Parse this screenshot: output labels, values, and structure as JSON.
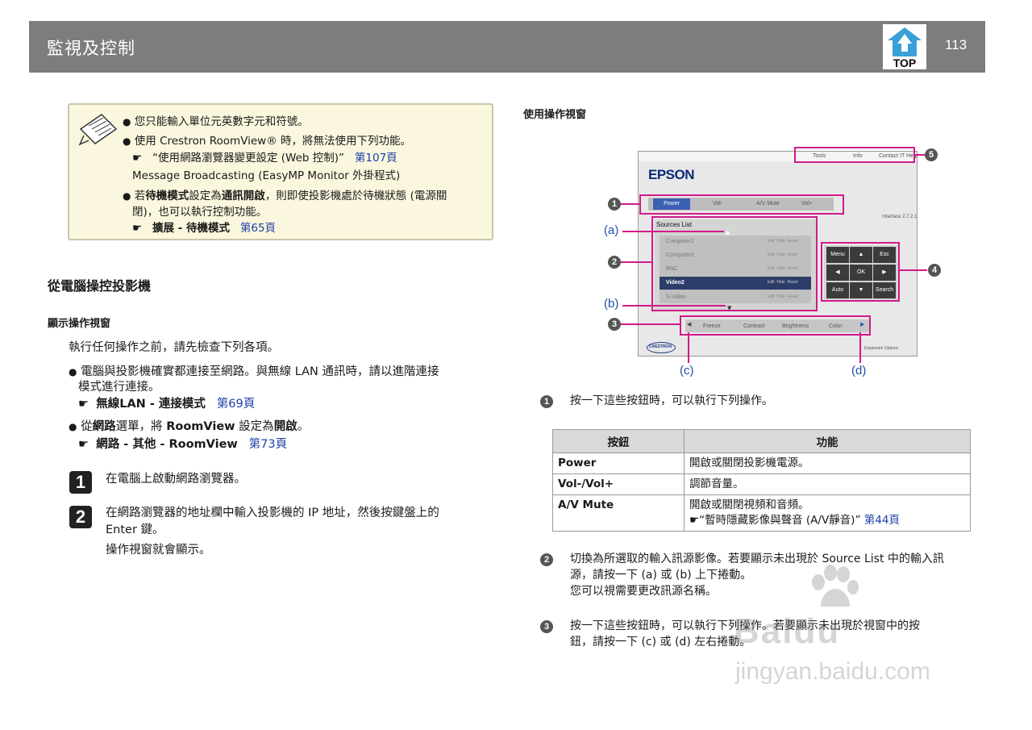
{
  "header": {
    "title": "監視及控制",
    "top_label": "TOP",
    "page_number": "113"
  },
  "note": {
    "bullet1": "您只能輸入單位元英數字元和符號。",
    "bullet2": "使用 Crestron RoomView® 時，將無法使用下列功能。",
    "bullet2_ref_text": "“使用網路瀏覽器變更設定 (Web 控制)”",
    "bullet2_ref_page": "第107頁",
    "bullet2_extra": "Message Broadcasting (EasyMP Monitor 外掛程式)",
    "bullet3_a": "若",
    "bullet3_b": "待機模式",
    "bullet3_c": "設定為",
    "bullet3_d": "通訊開啟",
    "bullet3_e": "，則即使投影機處於待機狀態 (電源關",
    "bullet3_line2": "閉)，也可以執行控制功能。",
    "bullet3_ref": "擴展 - 待機模式",
    "bullet3_ref_page": "第65頁"
  },
  "left": {
    "section_title": "從電腦操控投影機",
    "subsection_title": "顯示操作視窗",
    "intro": "執行任何操作之前，請先檢查下列各項。",
    "check1_line1": "電腦與投影機確實都連接至網路。與無線 LAN 通訊時，請以進階連接",
    "check1_line2": "模式進行連接。",
    "check1_ref": "無線LAN - 連接模式",
    "check1_ref_page": "第69頁",
    "check2_a": "從",
    "check2_b": "網路",
    "check2_c": "選單，將 ",
    "check2_d": "RoomView",
    "check2_e": " 設定為",
    "check2_f": "開啟",
    "check2_g": "。",
    "check2_ref": "網路 - 其他 - RoomView",
    "check2_ref_page": "第73頁",
    "step1_num": "1",
    "step1_text": "在電腦上啟動網路瀏覽器。",
    "step2_num": "2",
    "step2_line1": "在網路瀏覽器的地址欄中輸入投影機的 IP 地址，然後按鍵盤上的",
    "step2_line2": "Enter 鍵。",
    "step2_result": "操作視窗就會顯示。"
  },
  "right": {
    "section_title": "使用操作視窗",
    "screen": {
      "top_links": [
        "Tools",
        "Info",
        "Contact IT Help"
      ],
      "brand": "EPSON",
      "power_buttons": [
        "Power",
        "Vol-",
        "A/V Mute",
        "Vol+"
      ],
      "interface_version": "Interface 2.7.2.1",
      "sources_title": "Sources List",
      "sources": [
        "Computer1",
        "Computer2",
        "BNC",
        "Video2",
        "S-Video"
      ],
      "selected_source": "Video2",
      "source_actions": [
        "Edit",
        "Hide",
        "Reset"
      ],
      "nav_buttons": [
        "Menu",
        "▲",
        "Esc",
        "◀",
        "OK",
        "▶",
        "Auto",
        "▼",
        "Search"
      ],
      "bottom_buttons": [
        "Freeze",
        "Contrast",
        "Brightness",
        "Color"
      ],
      "crestron_logo": "CRESTRON",
      "expansion": "Expansion Options"
    },
    "callouts": {
      "n1": "1",
      "n2": "2",
      "n3": "3",
      "n4": "4",
      "n5": "5",
      "a": "(a)",
      "b": "(b)",
      "c": "(c)",
      "d": "(d)"
    },
    "item1_num": "1",
    "item1_text": "按一下這些按鈕時，可以執行下列操作。",
    "table": {
      "headers": [
        "按鈕",
        "功能"
      ],
      "rows": [
        {
          "button": "Power",
          "function": "開啟或關閉投影機電源。"
        },
        {
          "button": "Vol-/Vol+",
          "function": "調節音量。"
        },
        {
          "button": "A/V Mute",
          "function": "開啟或關閉視頻和音頻。",
          "ref": "“暫時隱藏影像與聲音 (A/V靜音)”",
          "ref_page": "第44頁"
        }
      ]
    },
    "item2_num": "2",
    "item2_line1": "切換為所選取的輸入訊源影像。若要顯示未出現於 Source List 中的輸入訊",
    "item2_line2": "源，請按一下 (a) 或 (b) 上下捲動。",
    "item2_line3": "您可以視需要更改訊源名稱。",
    "item3_num": "3",
    "item3_line1": "按一下這些按鈕時，可以執行下列操作。若要顯示未出現於視窗中的按",
    "item3_line2": "鈕，請按一下 (c) 或 (d) 左右捲動。"
  },
  "watermark": {
    "brand": "Baidu",
    "url": "jingyan.baidu.com"
  }
}
